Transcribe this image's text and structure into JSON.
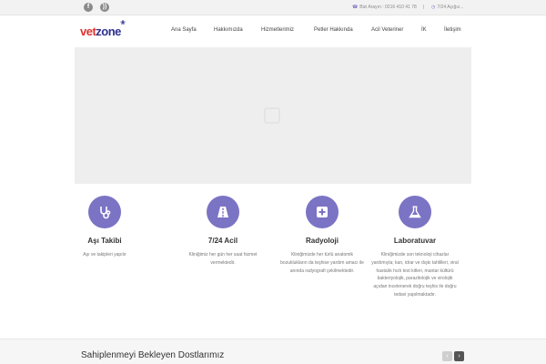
{
  "topbar": {
    "social": [
      {
        "icon": "facebook-icon",
        "glyph": "f"
      },
      {
        "icon": "rss-icon",
        "glyph": "))"
      }
    ],
    "phone_label": "Bizi Arayın : 0216 410 41 78",
    "separator": "|",
    "hours_label": "7/24 Açığız..."
  },
  "header": {
    "logo_part1": "vet",
    "logo_part2": "zone",
    "nav": [
      "Ana Sayfa",
      "Hakkımızda",
      "Hizmetlerimiz",
      "Petler Hakkında",
      "Acil Veteriner",
      "İK",
      "İletişim"
    ]
  },
  "slider": {
    "icon": "image-placeholder-icon"
  },
  "features": [
    {
      "icon": "stethoscope-icon",
      "title": "Aşı Takibi",
      "desc": "Aşı ve takipleri yapılır"
    },
    {
      "icon": "road-icon",
      "title": "7/24 Acil",
      "desc": "Kliniğimiz her gün her saat hizmet vermektedir."
    },
    {
      "icon": "plus-square-icon",
      "title": "Radyoloji",
      "desc": "Kliniğimizde her türlü anatomik bozuklukların da teşhise yardım amacı ile anında radyografi çekilmektedir."
    },
    {
      "icon": "flask-icon",
      "title": "Laboratuvar",
      "desc": "Kliniğimizde son teknoloji cihazlar yardımıyla; kan, idrar ve dışkı tahlilleri, viral hastalık hızlı test kitleri, mantar kültürü bakteriyolojik, parazitolojik ve virolojik açıdan incelenerek doğru teşhis ile doğru tedavi yapılmaktadır."
    }
  ],
  "bottom": {
    "title": "Sahiplenmeyi Bekleyen Dostlarımız",
    "prev": "‹",
    "next": "›"
  },
  "colors": {
    "accent": "#7b73c4",
    "logo_red": "#e0312e",
    "logo_blue": "#2d2f8f"
  }
}
